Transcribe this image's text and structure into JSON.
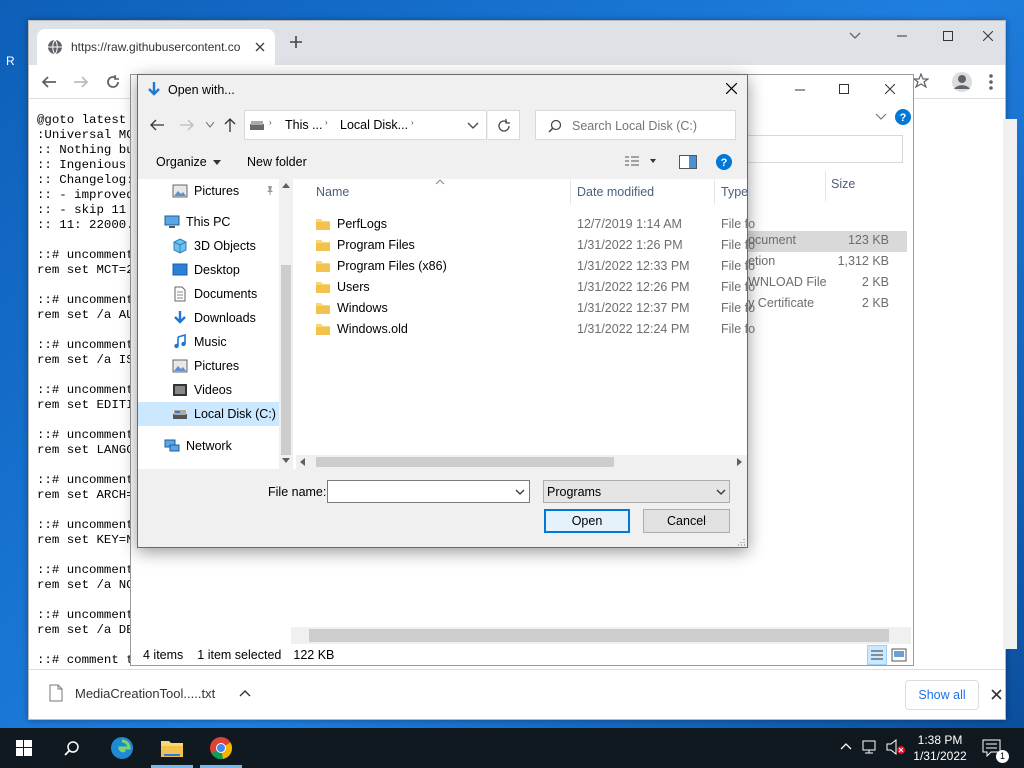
{
  "desktop": {
    "edge_letter": "R"
  },
  "browser": {
    "tab_title": "https://raw.githubusercontent.co",
    "code_lines": [
      "@goto latest",
      ":Universal MC",
      ":: Nothing bu",
      ":: Ingenious",
      ":: Changelog:",
      ":: - improved",
      ":: - skip 11",
      ":: 11: 22000.",
      "",
      "::# uncomment",
      "rem set MCT=2",
      "",
      "::# uncomment",
      "rem set /a AU",
      "",
      "::# uncomment",
      "rem set /a IS",
      "",
      "::# uncomment",
      "rem set EDITI",
      "",
      "::# uncomment",
      "rem set LANGC",
      "",
      "::# uncomment",
      "rem set ARCH=",
      "",
      "::# uncomment",
      "rem set KEY=N",
      "",
      "::# uncomment",
      "rem set /a NO",
      "",
      "::# uncomment",
      "rem set /a DE",
      "",
      "::# comment t"
    ],
    "download_file": "MediaCreationTool.....txt",
    "show_all": "Show all"
  },
  "explorer": {
    "size_header": "Size",
    "type_col": [
      "File",
      "File focument",
      "File fetion",
      "File fWNLOAD File",
      "File fy Certificate",
      "File f"
    ],
    "size_col": [
      "",
      "123 KB",
      "1,312 KB",
      "2 KB",
      "2 KB",
      ""
    ],
    "status_items": "4 items",
    "status_selected": "1 item selected",
    "status_size": "122 KB"
  },
  "dialog": {
    "title": "Open with...",
    "breadcrumb": [
      "This ...",
      "Local Disk..."
    ],
    "search_placeholder": "Search Local Disk (C:)",
    "organize": "Organize",
    "new_folder": "New folder",
    "nav_items": [
      {
        "label": "Pictures",
        "icon": "pictures-icon"
      },
      {
        "label": "This PC",
        "icon": "pc-icon"
      },
      {
        "label": "3D Objects",
        "icon": "3d-objects-icon"
      },
      {
        "label": "Desktop",
        "icon": "desktop-icon"
      },
      {
        "label": "Documents",
        "icon": "documents-icon"
      },
      {
        "label": "Downloads",
        "icon": "downloads-icon"
      },
      {
        "label": "Music",
        "icon": "music-icon"
      },
      {
        "label": "Pictures",
        "icon": "pictures-icon"
      },
      {
        "label": "Videos",
        "icon": "videos-icon"
      },
      {
        "label": "Local Disk (C:)",
        "icon": "drive-icon"
      },
      {
        "label": "Network",
        "icon": "network-icon"
      }
    ],
    "columns": {
      "name": "Name",
      "date": "Date modified",
      "type": "Type"
    },
    "files": [
      {
        "name": "PerfLogs",
        "date": "12/7/2019 1:14 AM",
        "type": "File fo"
      },
      {
        "name": "Program Files",
        "date": "1/31/2022 1:26 PM",
        "type": "File fo"
      },
      {
        "name": "Program Files (x86)",
        "date": "1/31/2022 12:33 PM",
        "type": "File fo"
      },
      {
        "name": "Users",
        "date": "1/31/2022 12:26 PM",
        "type": "File fo"
      },
      {
        "name": "Windows",
        "date": "1/31/2022 12:37 PM",
        "type": "File fo"
      },
      {
        "name": "Windows.old",
        "date": "1/31/2022 12:24 PM",
        "type": "File fo"
      }
    ],
    "file_name_label": "File name:",
    "file_name_value": "",
    "file_type_value": "Programs",
    "open": "Open",
    "cancel": "Cancel"
  },
  "taskbar": {
    "time": "1:38 PM",
    "date": "1/31/2022",
    "notification_count": "1"
  },
  "colors": {
    "accent": "#0078d7",
    "folder": "#f8d775",
    "taskbar": "#101820"
  }
}
